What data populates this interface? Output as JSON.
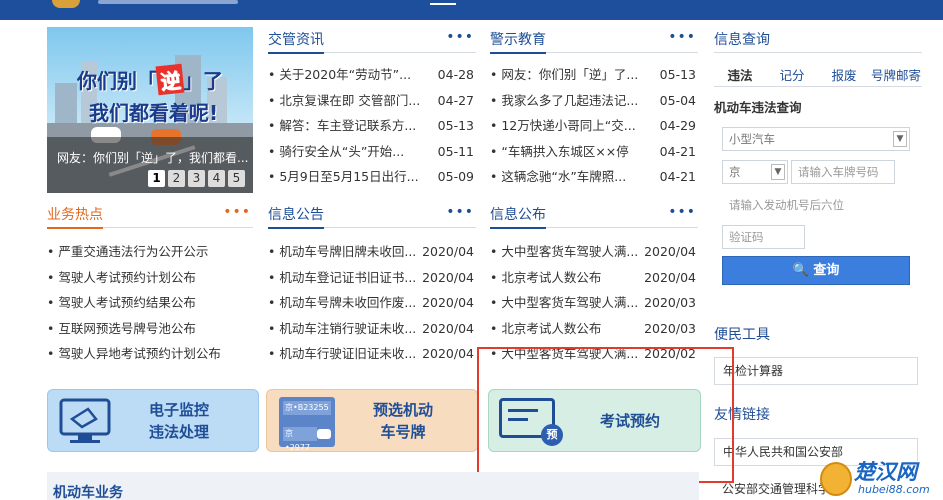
{
  "banner": {
    "line1_pre": "你们别「",
    "line1_red": "逆",
    "line1_post": "」了",
    "line2": "我们都看着呢!",
    "caption": "网友：你们别「逆」了，我们都看...",
    "pages": [
      "1",
      "2",
      "3",
      "4",
      "5"
    ]
  },
  "columns": {
    "traffic_news": {
      "title": "交管资讯",
      "more": "•••",
      "items": [
        {
          "text": "关于2020年“劳动节”...",
          "date": "04-28"
        },
        {
          "text": "北京复课在即 交管部门...",
          "date": "04-27"
        },
        {
          "text": "解答：车主登记联系方...",
          "date": "05-13"
        },
        {
          "text": "骑行安全从“头”开始...",
          "date": "05-11"
        },
        {
          "text": "5月9日至5月15日出行...",
          "date": "05-09"
        }
      ]
    },
    "warning_edu": {
      "title": "警示教育",
      "more": "•••",
      "items": [
        {
          "text": "网友：你们别「逆」了...",
          "date": "05-13"
        },
        {
          "text": "我家么多了几起违法记...",
          "date": "05-04"
        },
        {
          "text": "12万快递小哥同上“交...",
          "date": "04-29"
        },
        {
          "text": "“车辆拱入东城区××停",
          "date": "04-21"
        },
        {
          "text": "这辆念驰“水”车牌照...",
          "date": "04-21"
        }
      ]
    },
    "business_hot": {
      "title": "业务热点",
      "more": "•••",
      "items": [
        {
          "text": "严重交通违法行为公开公示"
        },
        {
          "text": "驾驶人考试预约计划公布"
        },
        {
          "text": "驾驶人考试预约结果公布"
        },
        {
          "text": "互联网预选号牌号池公布"
        },
        {
          "text": "驾驶人异地考试预约计划公布"
        }
      ]
    },
    "info_notice": {
      "title": "信息公告",
      "more": "•••",
      "items": [
        {
          "text": "机动车号牌旧牌未收回...",
          "date": "2020/04"
        },
        {
          "text": "机动车登记证书旧证书...",
          "date": "2020/04"
        },
        {
          "text": "机动车号牌未收回作废...",
          "date": "2020/04"
        },
        {
          "text": "机动车注销行驶证未收...",
          "date": "2020/04"
        },
        {
          "text": "机动车行驶证旧证未收...",
          "date": "2020/04"
        }
      ]
    },
    "info_publish": {
      "title": "信息公布",
      "more": "•••",
      "items": [
        {
          "text": "大中型客货车驾驶人满...",
          "date": "2020/04"
        },
        {
          "text": "北京考试人数公布",
          "date": "2020/04"
        },
        {
          "text": "大中型客货车驾驶人满...",
          "date": "2020/03"
        },
        {
          "text": "北京考试人数公布",
          "date": "2020/03"
        },
        {
          "text": "大中型客货车驾驶人满...",
          "date": "2020/02"
        }
      ]
    }
  },
  "query": {
    "title": "信息查询",
    "tabs": [
      "违法",
      "记分",
      "报废",
      "号牌邮寄"
    ],
    "active_tab": "违法",
    "label": "机动车违法查询",
    "vehicle_type": "小型汽车",
    "province": "京",
    "plate_placeholder": "请输入车牌号码",
    "engine_placeholder": "请输入发动机号后六位",
    "captcha_placeholder": "验证码",
    "button": "查询"
  },
  "side": {
    "tools_title": "便民工具",
    "tool_item": "年检计算器",
    "links_title": "友情链接",
    "link1": "中华人民共和国公安部",
    "link2": "公安部交通管理科学"
  },
  "tiles": {
    "t1_line1": "电子监控",
    "t1_line2": "违法处理",
    "t2_line1": "预选机动",
    "t2_line2": "车号牌",
    "t2_card1": "京•B23255",
    "t2_card2": "京•2977",
    "t3_label": "考试预约",
    "t3_badge": "预"
  },
  "section": {
    "title": "机动车业务"
  },
  "watermark": {
    "main": "楚汉网",
    "sub": "hubei88.com"
  },
  "colors": {
    "brand_blue": "#1f4e96",
    "accent_orange": "#e0691f",
    "highlight_red": "#e23b2e"
  }
}
